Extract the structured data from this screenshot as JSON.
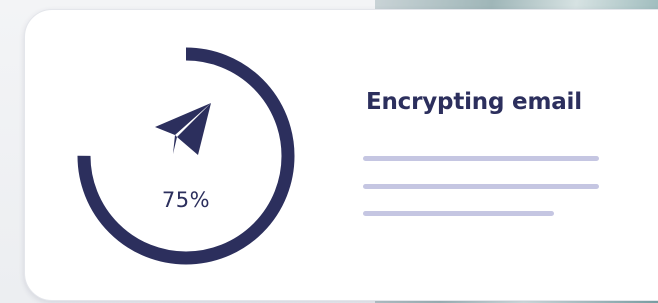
{
  "task": {
    "title": "Encrypting email",
    "progress_label": "75%",
    "progress": 0.75
  },
  "icons": {
    "main": "paper-plane-icon"
  },
  "colors": {
    "accent": "#2c2f5d",
    "placeholder_line": "#c5c6e2",
    "card_background": "#ffffff"
  }
}
